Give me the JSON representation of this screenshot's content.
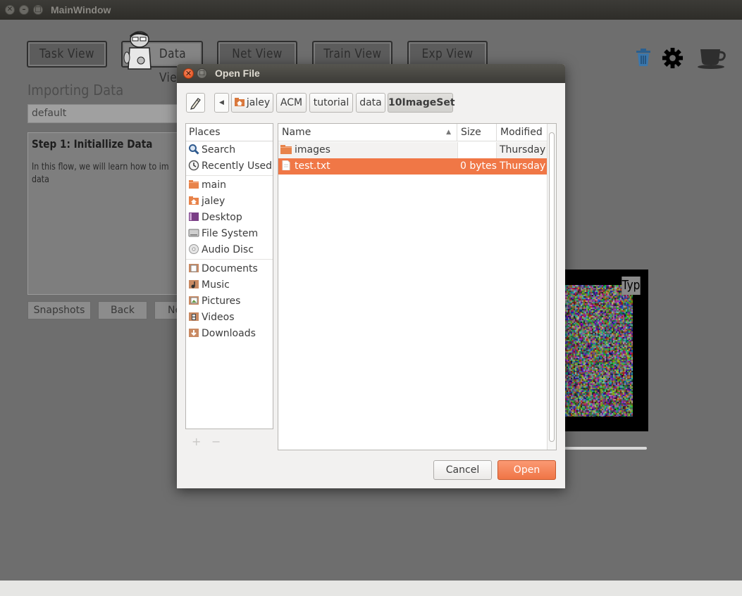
{
  "window": {
    "title": "MainWindow",
    "close_glyph": "✕",
    "min_glyph": "–",
    "max_glyph": "□"
  },
  "nav": {
    "tabs": [
      {
        "label": "Task View"
      },
      {
        "label": "Data View"
      },
      {
        "label": "Net View"
      },
      {
        "label": "Train View"
      },
      {
        "label": "Exp View"
      }
    ]
  },
  "main": {
    "section_title": "Importing Data",
    "dataset_value": "default",
    "step_title": "Step 1: Initiallize Data",
    "step_text": "In this flow, we will learn how to im data",
    "buttons": {
      "snapshots": "Snapshots",
      "back": "Back",
      "next": "Ne"
    },
    "preview_type_label": "Typ"
  },
  "toolbar_icons": [
    "trash-icon",
    "gear-icon",
    "coffee-cup-icon"
  ],
  "dialog": {
    "title": "Open File",
    "breadcrumbs": [
      "jaley",
      "ACM",
      "tutorial",
      "data",
      "10ImageSet"
    ],
    "places_header": "Places",
    "places": [
      {
        "label": "Search",
        "icon": "search-icon"
      },
      {
        "label": "Recently Used",
        "icon": "recent-icon"
      },
      {
        "label": "main",
        "icon": "folder-icon"
      },
      {
        "label": "jaley",
        "icon": "home-folder-icon"
      },
      {
        "label": "Desktop",
        "icon": "desktop-icon"
      },
      {
        "label": "File System",
        "icon": "drive-icon"
      },
      {
        "label": "Audio Disc",
        "icon": "disc-icon"
      },
      {
        "label": "Documents",
        "icon": "documents-icon"
      },
      {
        "label": "Music",
        "icon": "music-icon"
      },
      {
        "label": "Pictures",
        "icon": "pictures-icon"
      },
      {
        "label": "Videos",
        "icon": "videos-icon"
      },
      {
        "label": "Downloads",
        "icon": "downloads-icon"
      }
    ],
    "add_glyph": "+",
    "remove_glyph": "−",
    "columns": {
      "name": "Name",
      "size": "Size",
      "modified": "Modified",
      "sort_glyph": "▲"
    },
    "files": [
      {
        "name": "images",
        "size": "",
        "modified": "Thursday",
        "type": "folder",
        "selected": false
      },
      {
        "name": "test.txt",
        "size": "0 bytes",
        "modified": "Thursday",
        "type": "file",
        "selected": true
      }
    ],
    "cancel_label": "Cancel",
    "open_label": "Open",
    "nav_back_glyph": "◀"
  },
  "colors": {
    "accent": "#f07746",
    "selection": "#f07746",
    "dim_background": "#6e6e6e"
  }
}
